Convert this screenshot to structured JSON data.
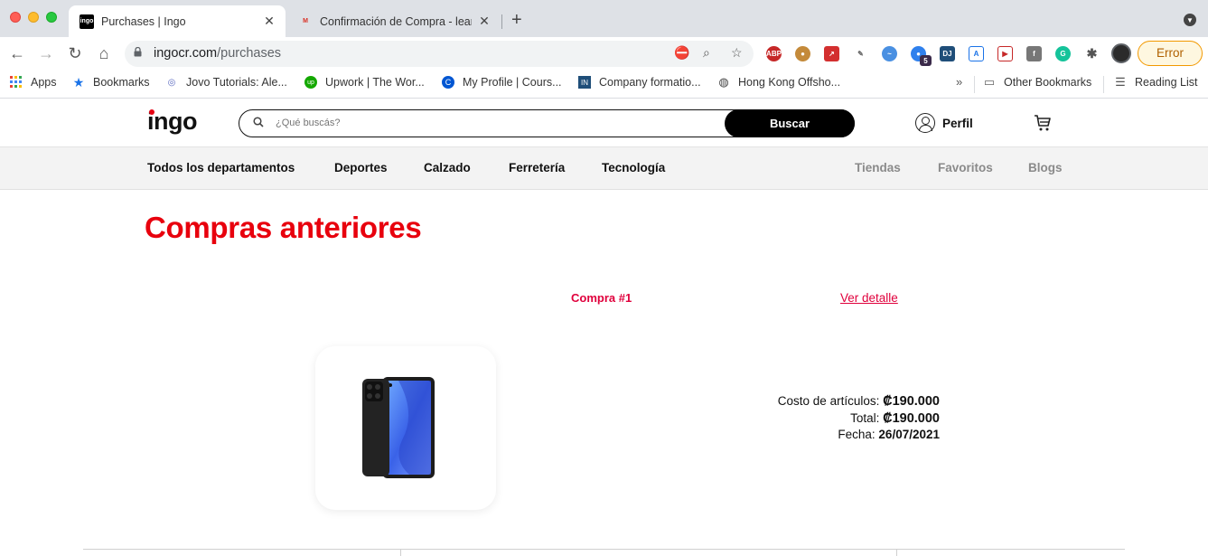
{
  "browser": {
    "tabs": [
      {
        "title": "Purchases | Ingo",
        "favicon": "ingo-favicon",
        "active": true
      },
      {
        "title": "Confirmación de Compra - lear",
        "favicon": "gmail-favicon",
        "active": false
      }
    ],
    "url_host": "ingocr.com",
    "url_path": "/purchases",
    "profile_button": "Error",
    "bookmarks": [
      {
        "label": "Apps",
        "icon": "apps-grid-icon"
      },
      {
        "label": "Bookmarks",
        "icon": "star-icon"
      },
      {
        "label": "Jovo Tutorials: Ale...",
        "icon": "jovo-icon"
      },
      {
        "label": "Upwork | The Wor...",
        "icon": "upwork-icon"
      },
      {
        "label": "My Profile | Cours...",
        "icon": "coursera-icon"
      },
      {
        "label": "Company formatio...",
        "icon": "inv-icon"
      },
      {
        "label": "Hong Kong Offsho...",
        "icon": "globe-icon"
      }
    ],
    "bookmarks_overflow": "»",
    "other_bookmarks": "Other Bookmarks",
    "reading_list": "Reading List",
    "extension_badge": "5"
  },
  "site": {
    "logo": "ingo",
    "search_placeholder": "¿Qué buscás?",
    "search_button": "Buscar",
    "profile_label": "Perfil",
    "departments": [
      "Todos los departamentos",
      "Deportes",
      "Calzado",
      "Ferretería",
      "Tecnología"
    ],
    "secondary_nav": [
      "Tiendas",
      "Favoritos",
      "Blogs"
    ]
  },
  "purchases": {
    "page_title": "Compras anteriores",
    "orders": [
      {
        "label": "Compra #1",
        "detail_link": "Ver detalle",
        "items_cost_label": "Costo de artículos:",
        "items_cost": "₡190.000",
        "total_label": "Total:",
        "total": "₡190.000",
        "date_label": "Fecha:",
        "date": "26/07/2021"
      }
    ]
  },
  "colors": {
    "brand_red": "#e8000d",
    "link_red": "#e0003c",
    "search_button_bg": "#000000"
  }
}
